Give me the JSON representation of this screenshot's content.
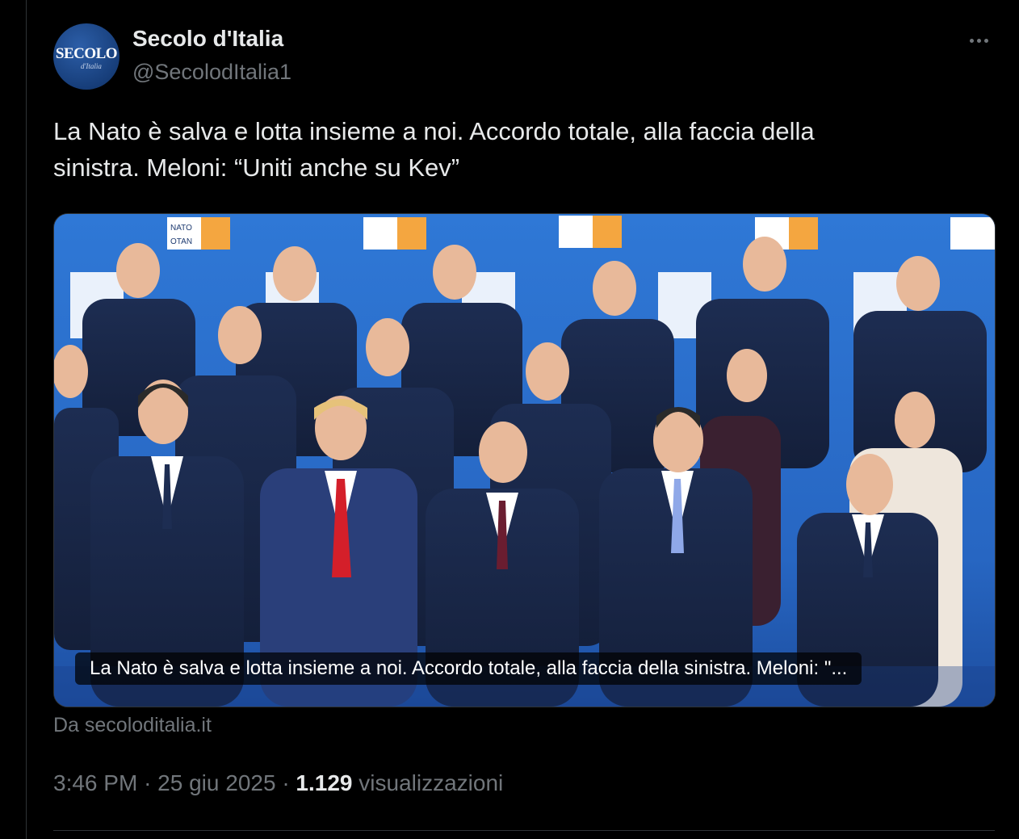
{
  "author": {
    "display_name": "Secolo d'Italia",
    "handle": "@SecolodItalia1",
    "avatar_logo_text": "SECOLO",
    "avatar_logo_subtext": "d'Italia"
  },
  "tweet": {
    "text": "La Nato è salva e lotta insieme a noi. Accordo totale, alla faccia della\nsinistra. Meloni: “Uniti anche su Kev”"
  },
  "link_card": {
    "image_description_icon": "group-photo",
    "caption": "La Nato è salva e lotta insieme a noi. Accordo totale, alla faccia della sinistra. Meloni: \"...",
    "backdrop_sign_text": [
      "NATO",
      "OTAN"
    ],
    "source": "Da secoloditalia.it"
  },
  "meta": {
    "time": "3:46 PM",
    "separator": "·",
    "date": "25 giu 2025",
    "views_count": "1.129",
    "views_label": "visualizzazioni"
  },
  "colors": {
    "background": "#000000",
    "text_primary": "#e7e9ea",
    "text_secondary": "#71767b",
    "border": "#2f3336",
    "backdrop_blue": "#2a6fd0"
  }
}
